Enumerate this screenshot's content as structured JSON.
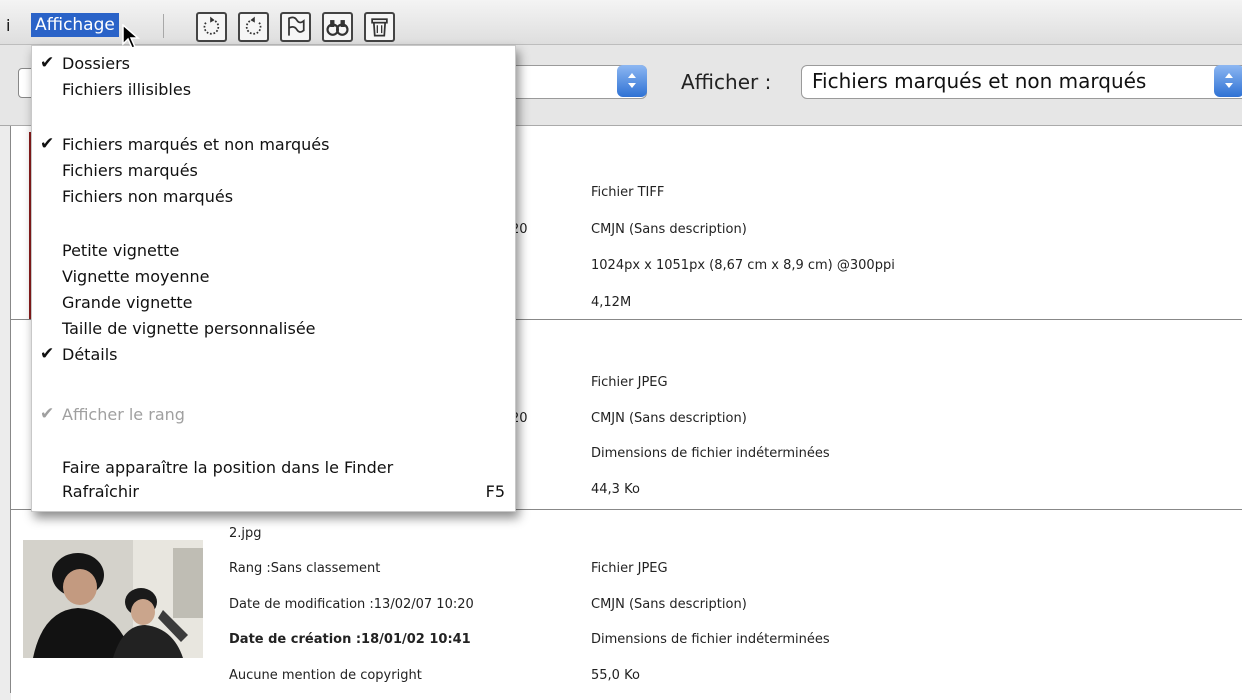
{
  "window": {
    "top_left_glyph": "i",
    "menu_title": "Affichage"
  },
  "toolbar": {
    "icons": [
      "rotate-left-icon",
      "rotate-right-icon",
      "flag-icon",
      "binoculars-icon",
      "trash-icon"
    ]
  },
  "filter": {
    "label": "Afficher :",
    "selected": "Fichiers marqués et non marqués"
  },
  "menu": {
    "items": [
      {
        "label": "Dossiers",
        "checked": true,
        "disabled": false
      },
      {
        "label": "Fichiers illisibles",
        "checked": false,
        "disabled": false
      },
      {
        "label": "Fichiers marqués et non marqués",
        "checked": true,
        "disabled": false
      },
      {
        "label": "Fichiers marqués",
        "checked": false,
        "disabled": false
      },
      {
        "label": "Fichiers non marqués",
        "checked": false,
        "disabled": false
      },
      {
        "label": "Petite vignette",
        "checked": false,
        "disabled": false
      },
      {
        "label": "Vignette moyenne",
        "checked": false,
        "disabled": false
      },
      {
        "label": "Grande vignette",
        "checked": false,
        "disabled": false
      },
      {
        "label": "Taille de vignette personnalisée",
        "checked": false,
        "disabled": false
      },
      {
        "label": "Détails",
        "checked": true,
        "disabled": false
      },
      {
        "label": "Afficher le rang",
        "checked": true,
        "disabled": true
      },
      {
        "label": "Faire apparaître la position dans le Finder",
        "checked": false,
        "disabled": false
      },
      {
        "label": "Rafraîchir",
        "checked": false,
        "disabled": false,
        "shortcut": "F5"
      }
    ]
  },
  "files": [
    {
      "partial_time": "20",
      "type": "Fichier TIFF",
      "color": "CMJN (Sans description)",
      "dimensions": "1024px x 1051px (8,67 cm x 8,9 cm) @300ppi",
      "size": "4,12M"
    },
    {
      "partial_time": "20",
      "type": "Fichier JPEG",
      "color": "CMJN (Sans description)",
      "dimensions": "Dimensions de fichier indéterminées",
      "size": "44,3 Ko"
    },
    {
      "name": "2.jpg",
      "rating": "Rang :Sans classement",
      "modified": "Date de modification :13/02/07  10:20",
      "created": "Date de création :18/01/02  10:41",
      "copyright": "Aucune mention de copyright",
      "type": "Fichier JPEG",
      "color": "CMJN (Sans description)",
      "dimensions": "Dimensions de fichier indéterminées",
      "size": "55,0 Ko"
    }
  ]
}
